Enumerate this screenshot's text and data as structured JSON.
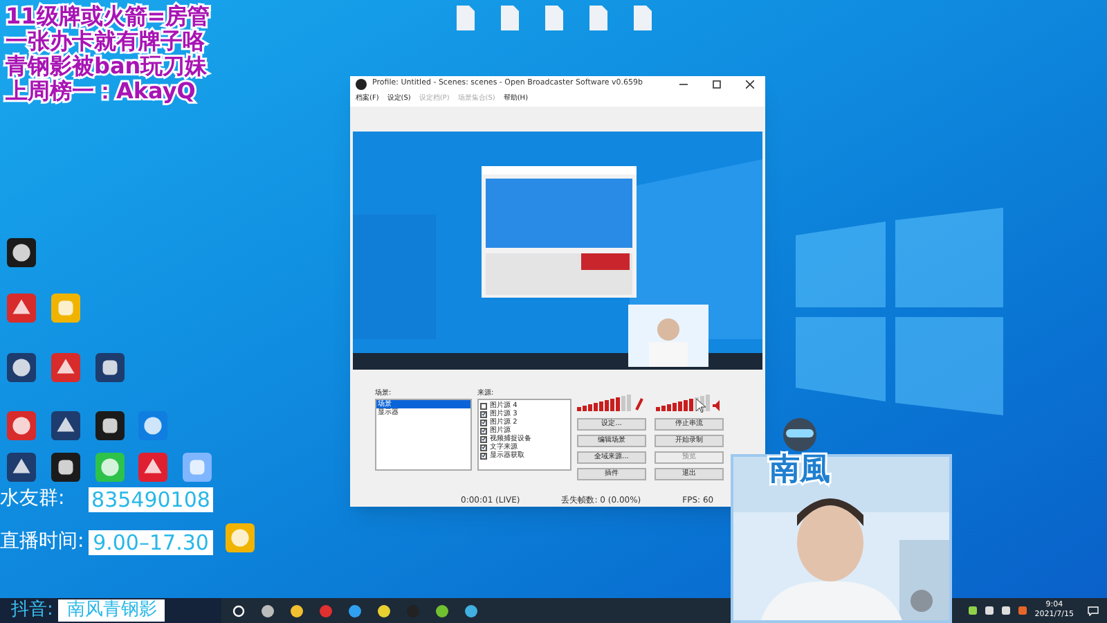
{
  "overlay_text": [
    "11级牌或火箭=房管",
    "一张办卡就有牌子咯",
    "青钢影被ban玩刀妹",
    "上周榜一：AkayQ"
  ],
  "obs": {
    "title": "Profile: Untitled - Scenes: scenes - Open Broadcaster Software v0.659b",
    "menu": [
      {
        "label": "档案(F)",
        "disabled": false
      },
      {
        "label": "设定(S)",
        "disabled": false
      },
      {
        "label": "设定档(P)",
        "disabled": true
      },
      {
        "label": "场景集合(S)",
        "disabled": true
      },
      {
        "label": "帮助(H)",
        "disabled": false
      }
    ],
    "scenes_label": "场景:",
    "scenes": [
      {
        "label": "场景",
        "selected": true
      },
      {
        "label": "显示器",
        "selected": false
      }
    ],
    "sources_label": "来源:",
    "sources": [
      {
        "label": "图片源 4",
        "checked": false
      },
      {
        "label": "图片源 3",
        "checked": true
      },
      {
        "label": "图片源 2",
        "checked": true
      },
      {
        "label": "图片源",
        "checked": true
      },
      {
        "label": "视频捕捉设备",
        "checked": true
      },
      {
        "label": "文字来源",
        "checked": true
      },
      {
        "label": "显示器获取",
        "checked": true
      }
    ],
    "meters": [
      {
        "kind": "mic",
        "level": 0.8
      },
      {
        "kind": "speaker",
        "level": 0.65
      }
    ],
    "buttons": [
      {
        "label": "设定...",
        "disabled": false
      },
      {
        "label": "停止串流",
        "disabled": false
      },
      {
        "label": "编辑场景",
        "disabled": false
      },
      {
        "label": "开始录制",
        "disabled": false
      },
      {
        "label": "全域来源...",
        "disabled": false
      },
      {
        "label": "预览",
        "disabled": true
      },
      {
        "label": "插件",
        "disabled": false
      },
      {
        "label": "退出",
        "disabled": false
      }
    ],
    "status": [
      "0:00:01 (LIVE)",
      "丢失帧数: 0 (0.00%)",
      "FPS: 60"
    ]
  },
  "info": [
    {
      "label": "水友群:",
      "value": "835490108"
    },
    {
      "label": "直播时间:",
      "value": "9.00–17.30"
    }
  ],
  "douyin": {
    "label": "抖音:",
    "value": "南风青钢影"
  },
  "sticker_text": "南風",
  "clock": {
    "time": "9:04",
    "date": "2021/7/15"
  }
}
